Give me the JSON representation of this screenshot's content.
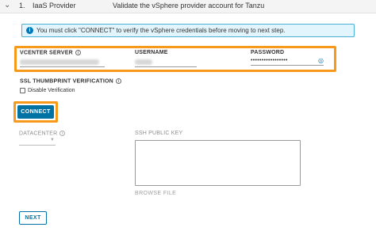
{
  "step": {
    "number": "1.",
    "name": "IaaS Provider",
    "description": "Validate the vSphere provider account for Tanzu"
  },
  "banner": {
    "text": "You must click \"CONNECT\" to verify the vSphere credentials before moving to next step."
  },
  "fields": {
    "vcenter_label": "VCENTER SERVER",
    "username_label": "USERNAME",
    "password_label": "PASSWORD",
    "password_value": "•••••••••••••••••"
  },
  "ssl": {
    "label": "SSL THUMBPRINT VERIFICATION",
    "checkbox_label": "Disable Verification"
  },
  "connect_label": "CONNECT",
  "datacenter_label": "DATACENTER",
  "ssh_label": "SSH PUBLIC KEY",
  "browse_label": "BROWSE FILE",
  "next_label": "NEXT",
  "colors": {
    "accent": "#0072a3",
    "highlight": "#f79a1c",
    "banner_bg": "#e3f5fc"
  }
}
